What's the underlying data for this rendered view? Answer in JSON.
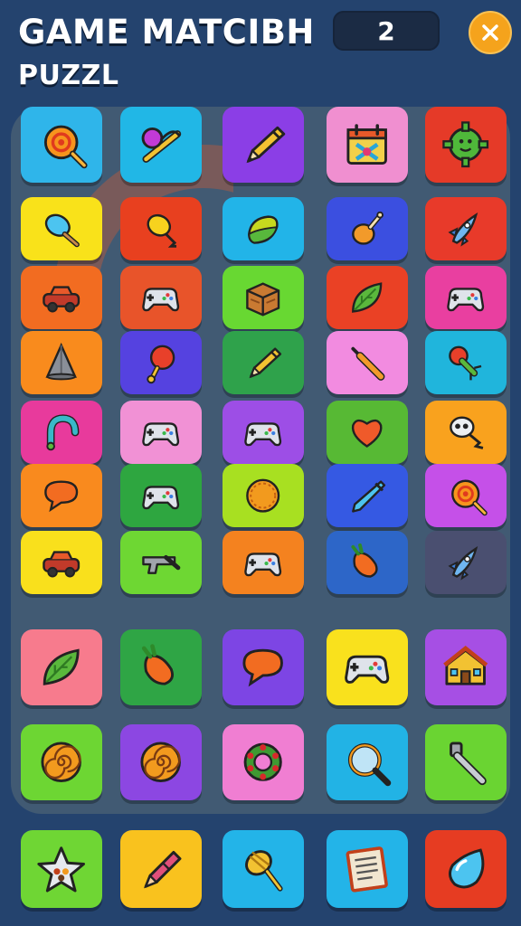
{
  "header": {
    "title_line1": "GAME MATCIBH",
    "title_line2": "PUZZL",
    "score": "2",
    "close_icon": "close-icon"
  },
  "board": {
    "rows": [
      [
        {
          "icon": "lollipop-icon",
          "color": "#2fb5ea"
        },
        {
          "icon": "slingshot-icon",
          "color": "#21b7e6"
        },
        {
          "icon": "pencil-icon",
          "color": "#8b3ee6"
        },
        {
          "icon": "calendar-icon",
          "color": "#f08fd0"
        },
        {
          "icon": "gear-icon",
          "color": "#e53a28"
        }
      ],
      [
        {
          "icon": "ice-pop-icon",
          "color": "#f9e21a"
        },
        {
          "icon": "balloon-icon",
          "color": "#e8401f"
        },
        {
          "icon": "lemon-icon",
          "color": "#22b4e8"
        },
        {
          "icon": "drumstick-icon",
          "color": "#3b4fe0"
        },
        {
          "icon": "rocket-icon",
          "color": "#e83a2a"
        }
      ],
      [
        {
          "icon": "toy-car-icon",
          "color": "#f26c21"
        },
        {
          "icon": "gamepad-icon",
          "color": "#e8542a"
        },
        {
          "icon": "wooden-box-icon",
          "color": "#68d832"
        },
        {
          "icon": "leaf-icon",
          "color": "#ea4125"
        },
        {
          "icon": "gamepad-icon",
          "color": "#e93fa0"
        }
      ],
      [
        {
          "icon": "cone-icon",
          "color": "#f98b1d"
        },
        {
          "icon": "rattle-icon",
          "color": "#5542e0"
        },
        {
          "icon": "pencil-icon",
          "color": "#2fa24b"
        },
        {
          "icon": "screwdriver-icon",
          "color": "#f28be0"
        },
        {
          "icon": "rocket-toy-icon",
          "color": "#20b5dc"
        }
      ],
      [
        {
          "icon": "horseshoe-icon",
          "color": "#e83a9c"
        },
        {
          "icon": "gamepad-icon",
          "color": "#f191d5"
        },
        {
          "icon": "gamepad-icon",
          "color": "#9d4ee6"
        },
        {
          "icon": "heart-icon",
          "color": "#57b934"
        },
        {
          "icon": "ghost-icon",
          "color": "#f9a21e"
        }
      ],
      [
        {
          "icon": "speech-bubble-icon",
          "color": "#f98a1e"
        },
        {
          "icon": "gamepad-icon",
          "color": "#2ea640"
        },
        {
          "icon": "orange-ring-icon",
          "color": "#a8e021"
        },
        {
          "icon": "pen-icon",
          "color": "#3559e3"
        },
        {
          "icon": "lollipop-icon",
          "color": "#c550e8"
        }
      ],
      [
        {
          "icon": "toy-car-icon",
          "color": "#f9e01c"
        },
        {
          "icon": "toy-gun-icon",
          "color": "#6ed733"
        },
        {
          "icon": "gamepad-icon",
          "color": "#f4821f"
        },
        {
          "icon": "carrot-icon",
          "color": "#2d66c8"
        },
        {
          "icon": "rocket-icon",
          "color": "#4a4f70"
        }
      ],
      [
        {
          "icon": "leaf-icon",
          "color": "#f77b8d"
        },
        {
          "icon": "carrot-icon",
          "color": "#2fa545"
        },
        {
          "icon": "speech-bubble-icon",
          "color": "#7d45e4"
        },
        {
          "icon": "gamepad-icon",
          "color": "#f9e11d"
        },
        {
          "icon": "house-icon",
          "color": "#a64fe4"
        }
      ],
      [
        {
          "icon": "spiral-icon",
          "color": "#6dd633"
        },
        {
          "icon": "spiral-icon",
          "color": "#8c47e2"
        },
        {
          "icon": "berry-wreath-icon",
          "color": "#f07ed2"
        },
        {
          "icon": "magnifier-icon",
          "color": "#22b3e5"
        },
        {
          "icon": "spray-icon",
          "color": "#6ad432"
        }
      ]
    ]
  },
  "tray": {
    "items": [
      {
        "icon": "star-icon",
        "color": "#6fd634"
      },
      {
        "icon": "crayon-icon",
        "color": "#f9c21e"
      },
      {
        "icon": "honey-dipper-icon",
        "color": "#23b4e8"
      },
      {
        "icon": "book-icon",
        "color": "#23b4e8"
      },
      {
        "icon": "water-drop-icon",
        "color": "#e63c22"
      }
    ]
  }
}
